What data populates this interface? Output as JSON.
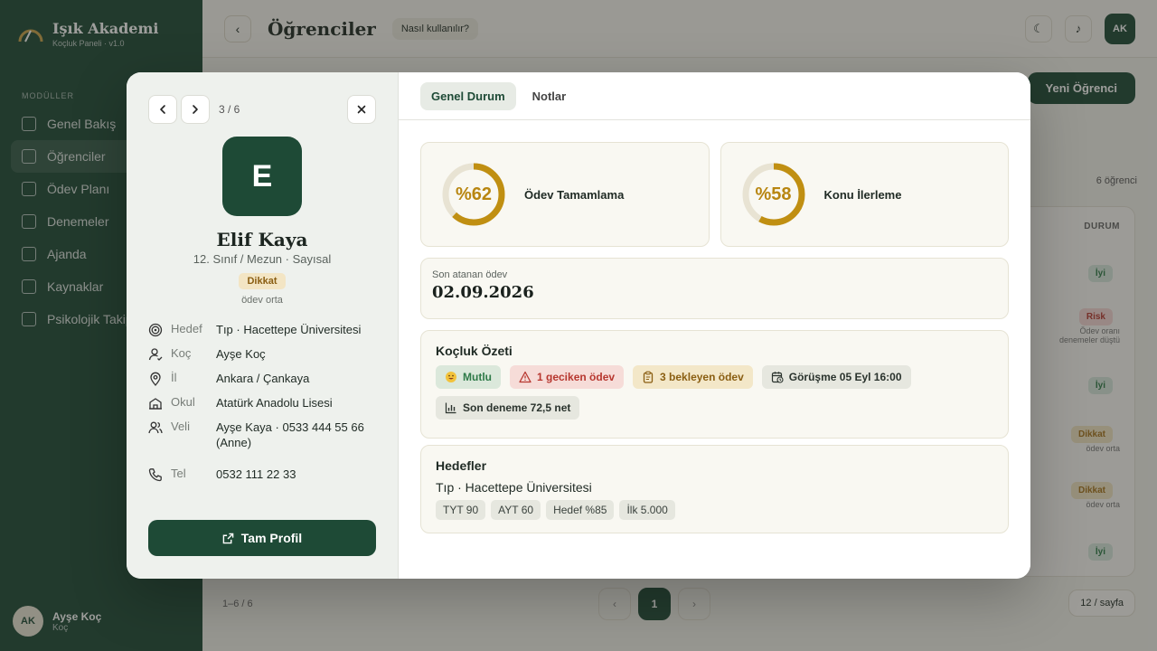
{
  "app": {
    "brand_title": "Işık Akademi",
    "brand_sub": "Koçluk Paneli · v1.0",
    "section": "MODÜLLER",
    "menu": [
      {
        "label": "Genel Bakış"
      },
      {
        "label": "Öğrenciler"
      },
      {
        "label": "Ödev Planı"
      },
      {
        "label": "Denemeler"
      },
      {
        "label": "Ajanda"
      },
      {
        "label": "Kaynaklar"
      },
      {
        "label": "Psikolojik Takip"
      }
    ],
    "user_initials": "AK",
    "user_name": "Ayşe Koç",
    "user_role": "Koç",
    "page_title": "Öğrenciler",
    "help_label": "Nasıl kullanılır?",
    "top_avatar": "AK",
    "new_button": "Yeni Öğrenci",
    "student_count": "6 öğrenci",
    "table_header": "DURUM",
    "rows": [
      {
        "status": "İyi",
        "kind": "g",
        "sub": ""
      },
      {
        "status": "Risk",
        "kind": "r",
        "sub": "Ödev oranı\ndenemeler düştü"
      },
      {
        "status": "İyi",
        "kind": "g",
        "sub": ""
      },
      {
        "status": "Dikkat",
        "kind": "y",
        "sub": "ödev orta"
      },
      {
        "status": "Dikkat",
        "kind": "y",
        "sub": "ödev orta"
      },
      {
        "status": "İyi",
        "kind": "g",
        "sub": ""
      }
    ],
    "pager_info": "1–6 / 6",
    "current_page": "1",
    "per_page": "12 / sayfa"
  },
  "modal": {
    "position": "3 / 6",
    "avatar_letter": "E",
    "name": "Elif Kaya",
    "subinfo": "12. Sınıf / Mezun · Sayısal",
    "status_badge": "Dikkat",
    "status_sub": "ödev orta",
    "info": [
      {
        "icon": "target-icon",
        "key": "Hedef",
        "value": "Tıp · Hacettepe Üniversitesi"
      },
      {
        "icon": "user-icon",
        "key": "Koç",
        "value": "Ayşe Koç"
      },
      {
        "icon": "location-pin-icon",
        "key": "İl",
        "value": "Ankara / Çankaya"
      },
      {
        "icon": "school-icon",
        "key": "Okul",
        "value": "Atatürk Anadolu Lisesi"
      },
      {
        "icon": "users-icon",
        "key": "Veli",
        "value": "Ayşe Kaya · 0533 444 55 66 (Anne)"
      },
      {
        "icon": "phone-icon",
        "key": "Tel",
        "value": "0532 111 22 33"
      }
    ],
    "profile_button": "Tam Profil",
    "tabs": [
      {
        "label": "Genel Durum"
      },
      {
        "label": "Notlar"
      }
    ],
    "progress": [
      {
        "value_label": "%62",
        "fraction": 0.62,
        "label": "Ödev Tamamlama"
      },
      {
        "value_label": "%58",
        "fraction": 0.58,
        "label": "Konu İlerleme"
      }
    ],
    "last_assignment_label": "Son atanan ödev",
    "last_assignment_date": "02.09.2026",
    "summary_title": "Koçluk Özeti",
    "chips": {
      "mood": "Mutlu",
      "late": "1 geciken ödev",
      "waiting": "3 bekleyen ödev",
      "meeting": "Görüşme 05 Eyl 16:00",
      "exam": "Son deneme 72,5 net"
    },
    "goals_title": "Hedefler",
    "goal_school": "Tıp · Hacettepe Üniversitesi",
    "goal_tags": [
      "TYT 90",
      "AYT 60",
      "Hedef %85",
      "İlk 5.000"
    ]
  },
  "colors": {
    "brand": "#1e4a36",
    "ring": "#c08f12",
    "ring_track": "#e8e3d3"
  }
}
